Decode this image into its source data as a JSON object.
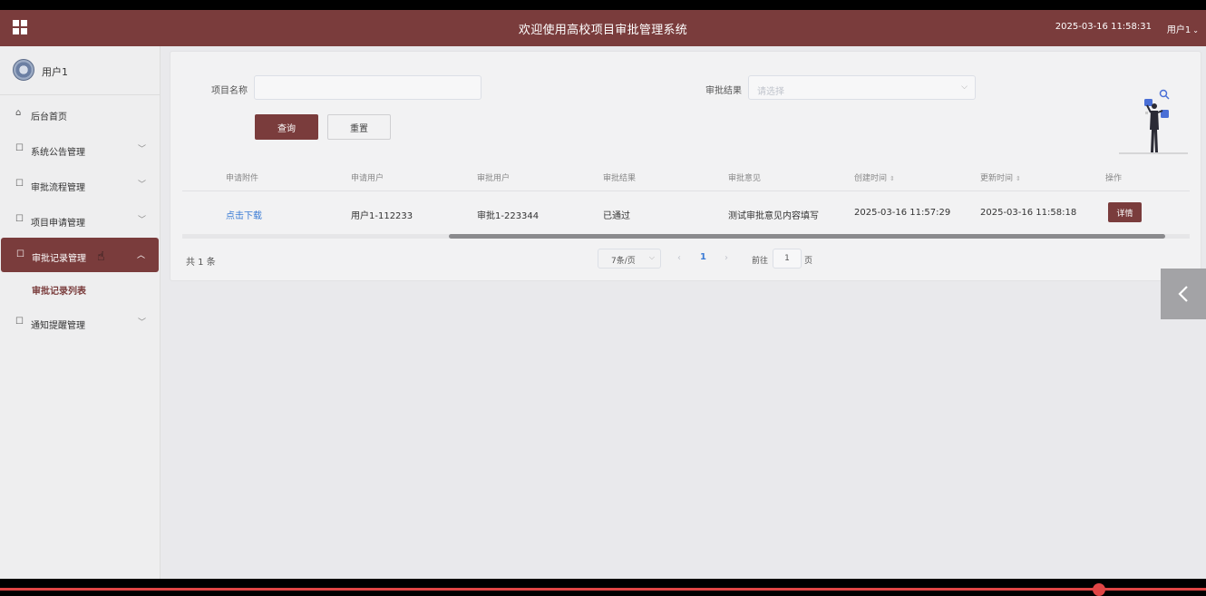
{
  "header": {
    "title": "欢迎使用高校项目审批管理系统",
    "datetime": "2025-03-16 11:58:31",
    "user_label": "用户1",
    "brand_color": "#7a3c3c"
  },
  "sidebar": {
    "username": "用户1",
    "items": [
      {
        "label": "后台首页",
        "icon": "home-icon"
      },
      {
        "label": "系统公告管理",
        "icon": "module-icon"
      },
      {
        "label": "审批流程管理",
        "icon": "module-icon"
      },
      {
        "label": "项目申请管理",
        "icon": "module-icon"
      },
      {
        "label": "审批记录管理",
        "icon": "module-icon",
        "active": true
      },
      {
        "label": "通知提醒管理",
        "icon": "module-icon"
      }
    ],
    "sub_items": [
      {
        "label": "审批记录列表"
      }
    ]
  },
  "search": {
    "project_name_label": "项目名称",
    "project_name_value": "",
    "result_label": "审批结果",
    "result_placeholder": "请选择",
    "query_button": "查询",
    "reset_button": "重置"
  },
  "table": {
    "columns": [
      "申请附件",
      "申请用户",
      "审批用户",
      "审批结果",
      "审批意见",
      "创建时间",
      "更新时间",
      "操作"
    ],
    "rows": [
      {
        "attachment": "点击下载",
        "applicant": "用户1-112233",
        "approver": "审批1-223344",
        "result": "已通过",
        "opinion": "测试审批意见内容填写",
        "created": "2025-03-16 11:57:29",
        "updated": "2025-03-16 11:58:18",
        "action": "详情"
      }
    ]
  },
  "pagination": {
    "total": "共 1 条",
    "page_size": "7条/页",
    "current_page": "1",
    "goto_label": "前往",
    "goto_value": "1",
    "page_suffix": "页"
  }
}
